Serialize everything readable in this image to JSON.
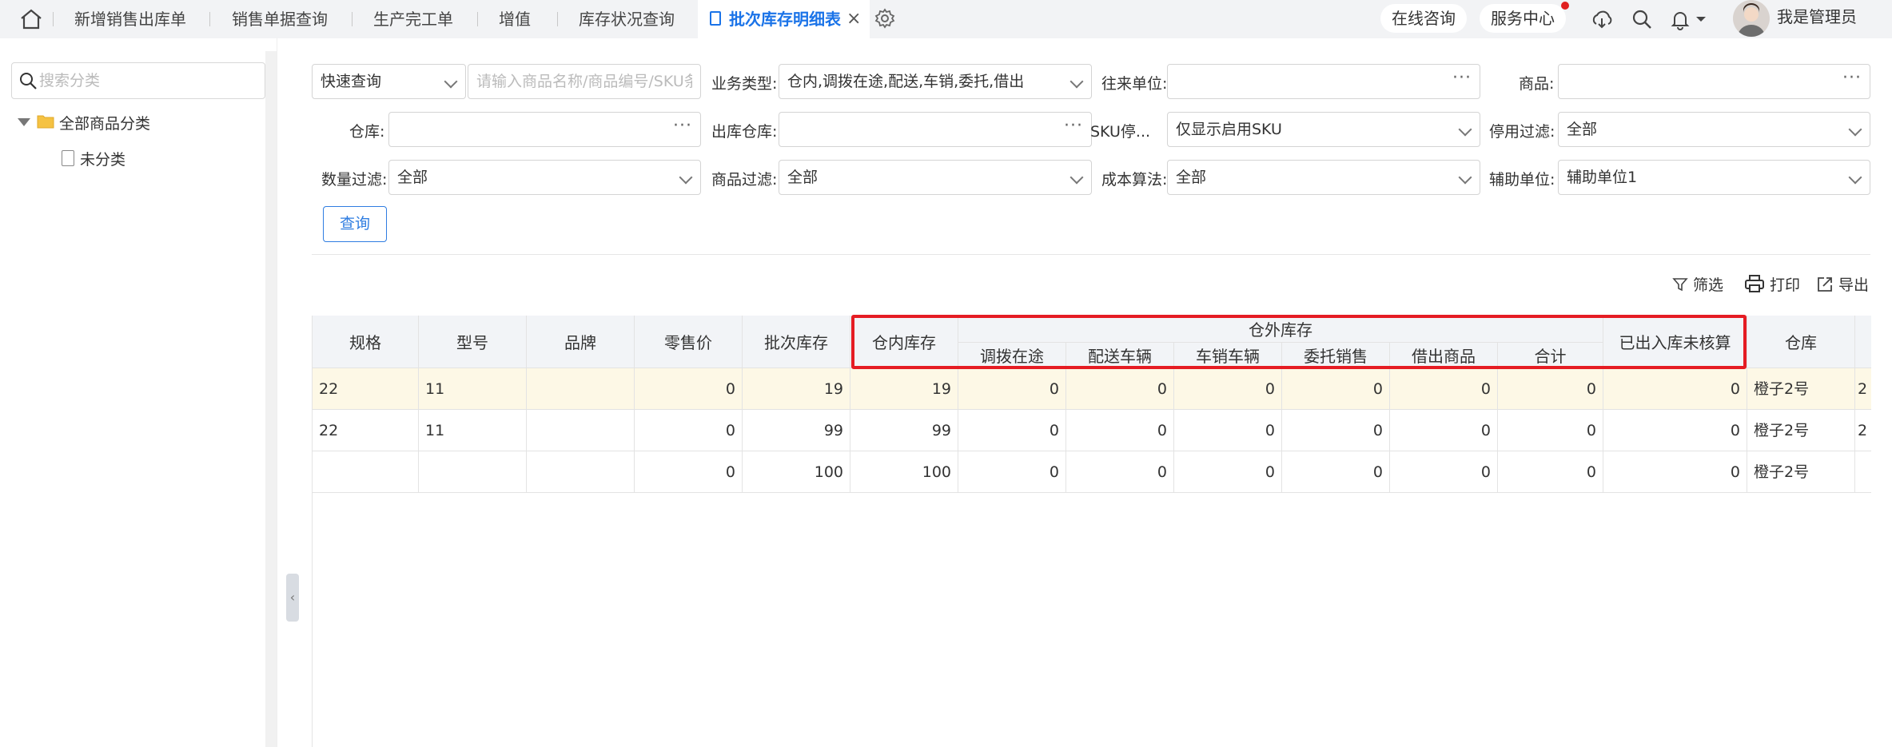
{
  "tabs": {
    "items": [
      "新增销售出库单",
      "销售单据查询",
      "生产完工单",
      "增值",
      "库存状况查询"
    ],
    "active": "批次库存明细表",
    "close": "×"
  },
  "topright": {
    "online": "在线咨询",
    "service": "服务中心",
    "username": "我是管理员"
  },
  "sidebar": {
    "search_placeholder": "搜索分类",
    "root": "全部商品分类",
    "child": "未分类"
  },
  "filters": {
    "quick_select": "快速查询",
    "quick_placeholder": "请输入商品名称/商品编号/SKU条...",
    "biz_type_label": "业务类型:",
    "biz_type_value": "仓内,调拨在途,配送,车销,委托,借出",
    "partner_label": "往来单位:",
    "product_label": "商品:",
    "warehouse_label": "仓库:",
    "out_warehouse_label": "出库仓库:",
    "sku_label": "SKU停...",
    "sku_value": "仅显示启用SKU",
    "disable_label": "停用过滤:",
    "disable_value": "全部",
    "qty_label": "数量过滤:",
    "qty_value": "全部",
    "goods_filter_label": "商品过滤:",
    "goods_filter_value": "全部",
    "cost_label": "成本算法:",
    "cost_value": "全部",
    "aux_label": "辅助单位:",
    "aux_value": "辅助单位1",
    "query_button": "查询",
    "dots": "···"
  },
  "actions": {
    "filter": "筛选",
    "print": "打印",
    "export": "导出"
  },
  "table": {
    "headers": {
      "spec": "规格",
      "model": "型号",
      "brand": "品牌",
      "retail": "零售价",
      "batch_stock": "批次库存",
      "in_stock": "仓内库存",
      "out_stock": "仓外库存",
      "transfer": "调拨在途",
      "delivery": "配送车辆",
      "car_sale": "车销车辆",
      "consign": "委托销售",
      "lend": "借出商品",
      "total": "合计",
      "unverified": "已出入库未核算",
      "warehouse": "仓库"
    },
    "rows": [
      {
        "spec": "22",
        "model": "11",
        "brand": "",
        "retail": "0",
        "batch": "19",
        "in": "19",
        "transfer": "0",
        "delivery": "0",
        "car": "0",
        "consign": "0",
        "lend": "0",
        "total": "0",
        "unverified": "0",
        "warehouse": "橙子2号",
        "extra": "2"
      },
      {
        "spec": "22",
        "model": "11",
        "brand": "",
        "retail": "0",
        "batch": "99",
        "in": "99",
        "transfer": "0",
        "delivery": "0",
        "car": "0",
        "consign": "0",
        "lend": "0",
        "total": "0",
        "unverified": "0",
        "warehouse": "橙子2号",
        "extra": "2"
      },
      {
        "spec": "",
        "model": "",
        "brand": "",
        "retail": "0",
        "batch": "100",
        "in": "100",
        "transfer": "0",
        "delivery": "0",
        "car": "0",
        "consign": "0",
        "lend": "0",
        "total": "0",
        "unverified": "0",
        "warehouse": "橙子2号",
        "extra": ""
      }
    ]
  },
  "colors": {
    "accent": "#1a73e8",
    "highlight_row": "#fdf8e6",
    "red_box": "#e51c23"
  }
}
